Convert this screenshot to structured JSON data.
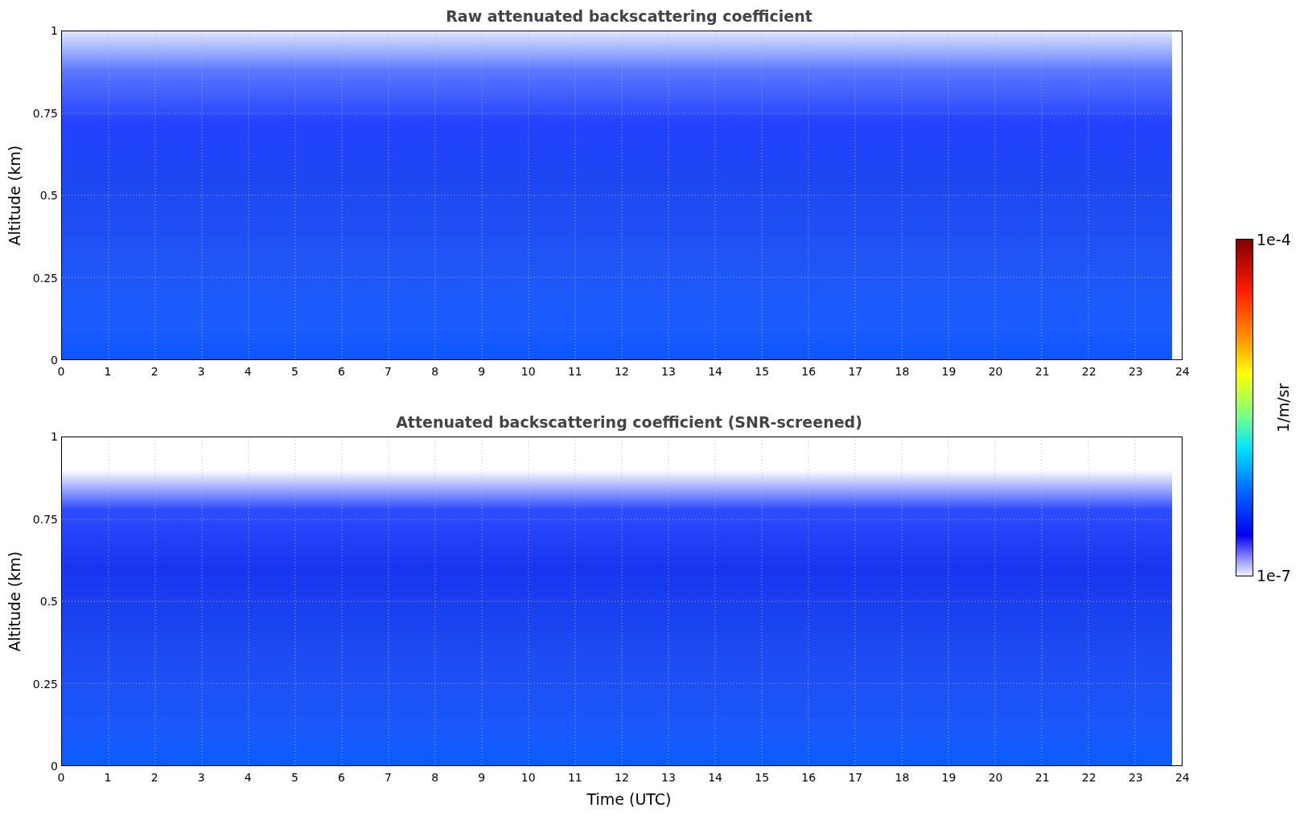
{
  "plots": [
    {
      "kind": "raw",
      "title": "Raw attenuated backscattering coefficient",
      "ylabel": "Altitude (km)",
      "yticks": [
        "1",
        "0.75",
        "0.5",
        "0.25",
        "0"
      ],
      "xticks": [
        "0",
        "1",
        "2",
        "3",
        "4",
        "5",
        "6",
        "7",
        "8",
        "9",
        "10",
        "11",
        "12",
        "13",
        "14",
        "15",
        "16",
        "17",
        "18",
        "19",
        "20",
        "21",
        "22",
        "23",
        "24"
      ]
    },
    {
      "kind": "screened",
      "title": "Attenuated backscattering coefficient (SNR-screened)",
      "ylabel": "Altitude (km)",
      "yticks": [
        "1",
        "0.75",
        "0.5",
        "0.25",
        "0"
      ],
      "xticks": [
        "0",
        "1",
        "2",
        "3",
        "4",
        "5",
        "6",
        "7",
        "8",
        "9",
        "10",
        "11",
        "12",
        "13",
        "14",
        "15",
        "16",
        "17",
        "18",
        "19",
        "20",
        "21",
        "22",
        "23",
        "24"
      ]
    }
  ],
  "xlabel": "Time (UTC)",
  "colorbar": {
    "max": "1e-4",
    "min": "1e-7",
    "label": "1/m/sr"
  }
}
